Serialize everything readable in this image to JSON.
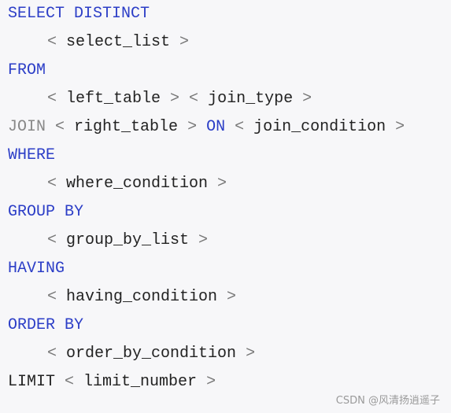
{
  "lines": [
    {
      "parts": [
        {
          "t": "SELECT DISTINCT",
          "c": "kw"
        }
      ]
    },
    {
      "indent": true,
      "parts": [
        {
          "t": "< ",
          "c": "punct"
        },
        {
          "t": "select_list",
          "c": "ident"
        },
        {
          "t": " >",
          "c": "punct"
        }
      ]
    },
    {
      "parts": [
        {
          "t": "FROM",
          "c": "kw"
        }
      ]
    },
    {
      "indent": true,
      "parts": [
        {
          "t": "< ",
          "c": "punct"
        },
        {
          "t": "left_table",
          "c": "ident"
        },
        {
          "t": " > < ",
          "c": "punct"
        },
        {
          "t": "join_type",
          "c": "ident"
        },
        {
          "t": " >",
          "c": "punct"
        }
      ]
    },
    {
      "parts": [
        {
          "t": "JOIN",
          "c": "kw-grey"
        },
        {
          "t": " < ",
          "c": "punct"
        },
        {
          "t": "right_table",
          "c": "ident"
        },
        {
          "t": " > ",
          "c": "punct"
        },
        {
          "t": "ON",
          "c": "kw"
        },
        {
          "t": " < ",
          "c": "punct"
        },
        {
          "t": "join_condition",
          "c": "ident"
        },
        {
          "t": " >",
          "c": "punct"
        }
      ]
    },
    {
      "parts": [
        {
          "t": "WHERE",
          "c": "kw"
        }
      ]
    },
    {
      "indent": true,
      "parts": [
        {
          "t": "< ",
          "c": "punct"
        },
        {
          "t": "where_condition",
          "c": "ident"
        },
        {
          "t": " >",
          "c": "punct"
        }
      ]
    },
    {
      "parts": [
        {
          "t": "GROUP BY",
          "c": "kw"
        }
      ]
    },
    {
      "indent": true,
      "parts": [
        {
          "t": "< ",
          "c": "punct"
        },
        {
          "t": "group_by_list",
          "c": "ident"
        },
        {
          "t": " >",
          "c": "punct"
        }
      ]
    },
    {
      "parts": [
        {
          "t": "HAVING",
          "c": "kw"
        }
      ]
    },
    {
      "indent": true,
      "parts": [
        {
          "t": "< ",
          "c": "punct"
        },
        {
          "t": "having_condition",
          "c": "ident"
        },
        {
          "t": " >",
          "c": "punct"
        }
      ]
    },
    {
      "parts": [
        {
          "t": "ORDER BY",
          "c": "kw"
        }
      ]
    },
    {
      "indent": true,
      "parts": [
        {
          "t": "< ",
          "c": "punct"
        },
        {
          "t": "order_by_condition",
          "c": "ident"
        },
        {
          "t": " >",
          "c": "punct"
        }
      ]
    },
    {
      "parts": [
        {
          "t": "LIMIT",
          "c": "ident"
        },
        {
          "t": " < ",
          "c": "punct"
        },
        {
          "t": "limit_number",
          "c": "ident"
        },
        {
          "t": " >",
          "c": "punct"
        }
      ]
    }
  ],
  "watermark": "CSDN @风清扬逍遥子"
}
